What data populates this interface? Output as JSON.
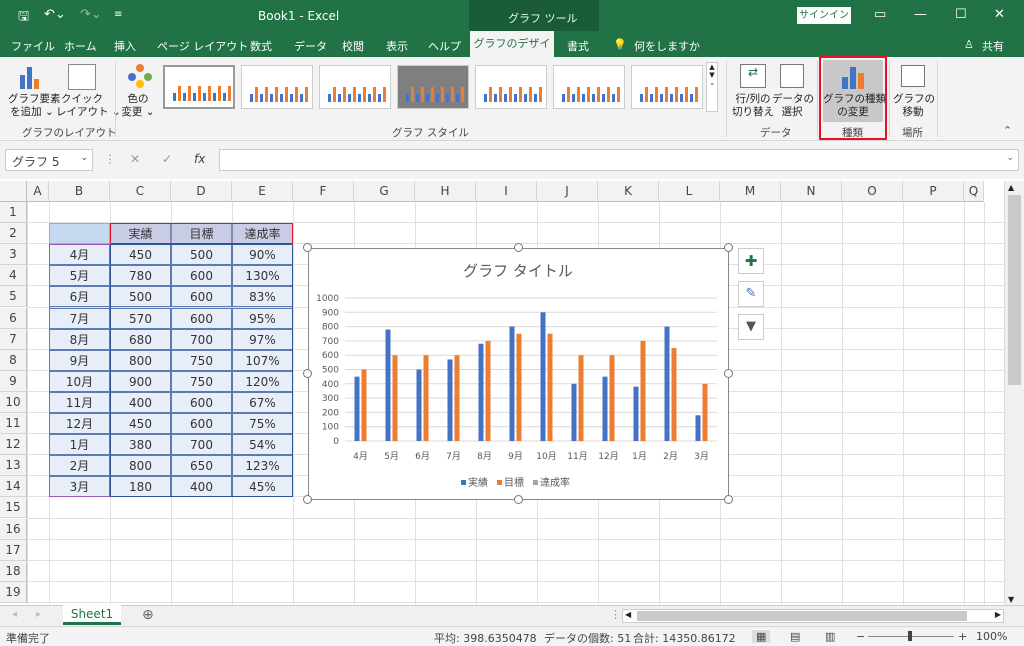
{
  "titlebar": {
    "title": "Book1  -  Excel",
    "tools": "グラフ ツール",
    "signin": "サインイン"
  },
  "tabs": [
    "ファイル",
    "ホーム",
    "挿入",
    "ページ レイアウト",
    "数式",
    "データ",
    "校閲",
    "表示",
    "ヘルプ"
  ],
  "active_tab": "グラフのデザイン",
  "tab_format": "書式",
  "tell_me": "何をしますか",
  "share": "共有",
  "ribbon": {
    "add_element": [
      "グラフ要素",
      "を追加 ⌄"
    ],
    "quick_layout": [
      "クイック",
      "レイアウト ⌄"
    ],
    "color": [
      "色の",
      "変更 ⌄"
    ],
    "switch_rowcol": [
      "行/列の",
      "切り替え"
    ],
    "select_data": [
      "データの",
      "選択"
    ],
    "change_type": [
      "グラフの種類",
      "の変更"
    ],
    "move_chart": [
      "グラフの",
      "移動"
    ],
    "groups": {
      "layout": "グラフのレイアウト",
      "styles": "グラフ スタイル",
      "data": "データ",
      "type": "種類",
      "location": "場所"
    }
  },
  "namebox": "グラフ 5",
  "fx": "fx",
  "columns": [
    "A",
    "B",
    "C",
    "D",
    "E",
    "F",
    "G",
    "H",
    "I",
    "J",
    "K",
    "L",
    "M",
    "N",
    "O",
    "P",
    "Q"
  ],
  "rows": [
    "1",
    "2",
    "3",
    "4",
    "5",
    "6",
    "7",
    "8",
    "9",
    "10",
    "11",
    "12",
    "13",
    "14",
    "15",
    "16",
    "17",
    "18",
    "19"
  ],
  "table": {
    "headers": [
      "実績",
      "目標",
      "達成率"
    ],
    "rows": [
      [
        "4月",
        "450",
        "500",
        "90%"
      ],
      [
        "5月",
        "780",
        "600",
        "130%"
      ],
      [
        "6月",
        "500",
        "600",
        "83%"
      ],
      [
        "7月",
        "570",
        "600",
        "95%"
      ],
      [
        "8月",
        "680",
        "700",
        "97%"
      ],
      [
        "9月",
        "800",
        "750",
        "107%"
      ],
      [
        "10月",
        "900",
        "750",
        "120%"
      ],
      [
        "11月",
        "400",
        "600",
        "67%"
      ],
      [
        "12月",
        "450",
        "600",
        "75%"
      ],
      [
        "1月",
        "380",
        "700",
        "54%"
      ],
      [
        "2月",
        "800",
        "650",
        "123%"
      ],
      [
        "3月",
        "180",
        "400",
        "45%"
      ]
    ]
  },
  "chart_data": {
    "type": "bar",
    "title": "グラフ タイトル",
    "categories": [
      "4月",
      "5月",
      "6月",
      "7月",
      "8月",
      "9月",
      "10月",
      "11月",
      "12月",
      "1月",
      "2月",
      "3月"
    ],
    "series": [
      {
        "name": "実績",
        "color": "#4472c4",
        "values": [
          450,
          780,
          500,
          570,
          680,
          800,
          900,
          400,
          450,
          380,
          800,
          180
        ]
      },
      {
        "name": "目標",
        "color": "#ed7d31",
        "values": [
          500,
          600,
          600,
          600,
          700,
          750,
          750,
          600,
          600,
          700,
          650,
          400
        ]
      },
      {
        "name": "達成率",
        "color": "#a5a5a5",
        "values": [
          0.9,
          1.3,
          0.83,
          0.95,
          0.97,
          1.07,
          1.2,
          0.67,
          0.75,
          0.54,
          1.23,
          0.45
        ]
      }
    ],
    "yticks": [
      "1000",
      "900",
      "800",
      "700",
      "600",
      "500",
      "400",
      "300",
      "200",
      "100",
      "0"
    ],
    "ylim": [
      0,
      1000
    ],
    "legend": "bottom",
    "grid": true
  },
  "sheet": {
    "name": "Sheet1"
  },
  "status": {
    "ready": "準備完了",
    "avg": "平均: 398.6350478",
    "count": "データの個数: 51",
    "sum": "合計: 14350.86172",
    "zoom": "100%"
  }
}
